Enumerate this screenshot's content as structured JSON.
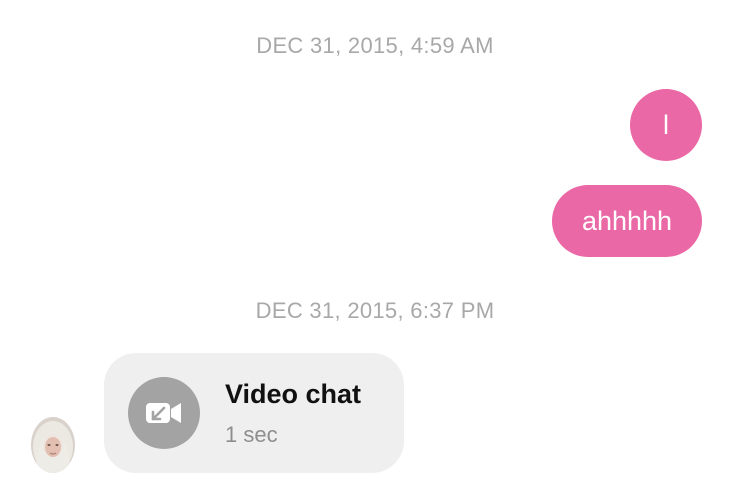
{
  "conversation": {
    "groups": [
      {
        "timestamp": "DEC 31, 2015, 4:59 AM",
        "messages": [
          {
            "direction": "outgoing",
            "text": "l"
          },
          {
            "direction": "outgoing",
            "text": "ahhhhh"
          }
        ]
      },
      {
        "timestamp": "DEC 31, 2015, 6:37 PM",
        "call": {
          "direction": "incoming",
          "title": "Video chat",
          "duration": "1 sec",
          "icon": "video-missed-icon"
        }
      }
    ]
  },
  "colors": {
    "outgoing_bubble": "#ea68a6",
    "call_card_bg": "#efefef",
    "call_icon_bg": "#a3a3a3",
    "timestamp_text": "#a8a8a8"
  }
}
